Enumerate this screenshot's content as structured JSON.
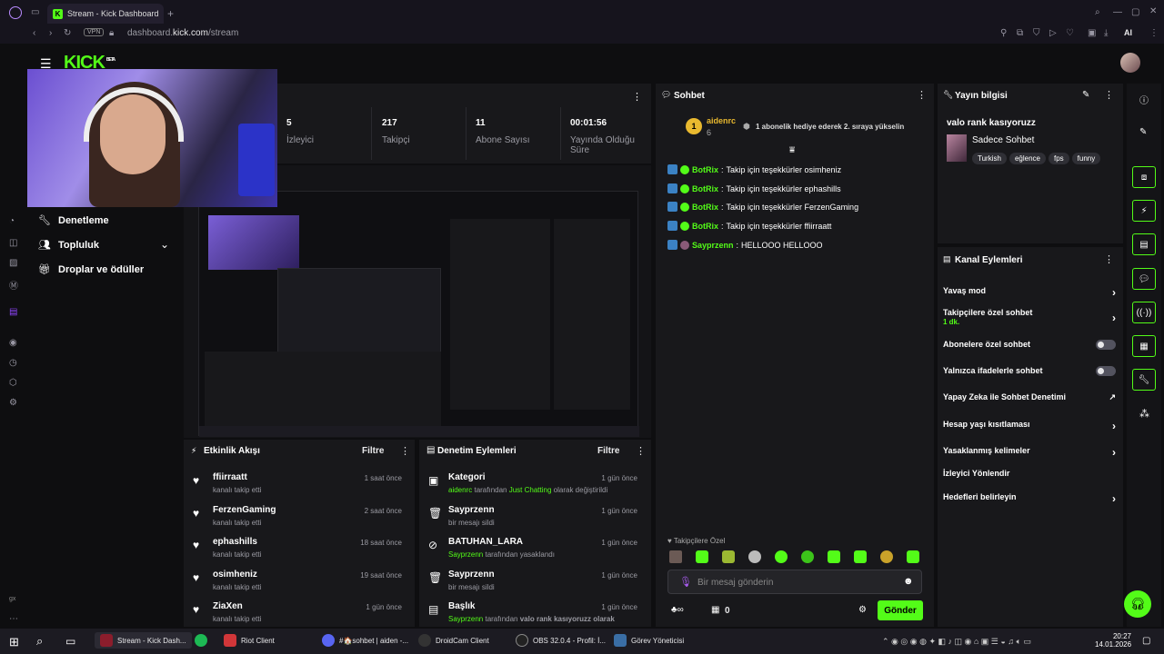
{
  "browser": {
    "tab_title": "Stream - Kick Dashboard",
    "url_domain": "dashboard.",
    "url_host": "kick.com",
    "url_path": "/stream",
    "vpn": "VPN",
    "ai_label": "AI"
  },
  "logo": {
    "text": "KICK",
    "beta": "BETA"
  },
  "sidebar": {
    "items": [
      {
        "label": "Denetleme",
        "icon": "wrench-icon"
      },
      {
        "label": "Topluluk",
        "icon": "users-icon"
      },
      {
        "label": "Droplar ve ödüller",
        "icon": "gift-icon"
      }
    ],
    "footer": "gx"
  },
  "stats": [
    {
      "value": "5",
      "label": "İzleyici"
    },
    {
      "value": "217",
      "label": "Takipçi"
    },
    {
      "value": "11",
      "label": "Abone Sayısı"
    },
    {
      "value": "00:01:56",
      "label": "Yayında Olduğu Süre"
    }
  ],
  "activity": {
    "title": "Etkinlik Akışı",
    "filter": "Filtre",
    "items": [
      {
        "name": "ffiirraatt",
        "sub": "kanalı takip etti",
        "time": "1 saat önce"
      },
      {
        "name": "FerzenGaming",
        "sub": "kanalı takip etti",
        "time": "2 saat önce"
      },
      {
        "name": "ephashills",
        "sub": "kanalı takip etti",
        "time": "18 saat önce"
      },
      {
        "name": "osimheniz",
        "sub": "kanalı takip etti",
        "time": "19 saat önce"
      },
      {
        "name": "ZiaXen",
        "sub": "kanalı takip etti",
        "time": "1 gün önce"
      }
    ]
  },
  "moderation": {
    "title": "Denetim Eylemleri",
    "filter": "Filtre",
    "items": [
      {
        "name": "Kategori",
        "actor": "aidenrc",
        "mid": " tarafından ",
        "hl": "Just Chatting",
        "rest": " olarak değiştirildi",
        "time": "1 gün önce",
        "icon": "category-icon"
      },
      {
        "name": "Sayprzenn",
        "actor": "",
        "mid": "bir mesajı sildi",
        "hl": "",
        "rest": "",
        "time": "1 gün önce",
        "icon": "trash-icon"
      },
      {
        "name": "BATUHAN_LARA",
        "actor": "Sayprzenn",
        "mid": " tarafından yasaklandı",
        "hl": "",
        "rest": "",
        "time": "1 gün önce",
        "icon": "ban-icon"
      },
      {
        "name": "Sayprzenn",
        "actor": "",
        "mid": "bir mesajı sildi",
        "hl": "",
        "rest": "",
        "time": "1 gün önce",
        "icon": "trash-icon"
      },
      {
        "name": "Başlık",
        "actor": "Sayprzenn",
        "mid": " tarafından ",
        "hl": "",
        "rest": "valo rank kasıyoruzz olarak",
        "time": "1 gün önce",
        "icon": "title-icon"
      }
    ]
  },
  "chat": {
    "title": "Sohbet",
    "pinned_user": "aidenrc",
    "pinned_count": "6",
    "pinned_rank": "1",
    "pinned_text": "1 abonelik hediye ederek 2. sıraya yükselin",
    "messages": [
      {
        "user": "BotRix",
        "text": "Takip için teşekkürler osimheniz",
        "color": "#53fc18"
      },
      {
        "user": "BotRix",
        "text": "Takip için teşekkürler ephashills",
        "color": "#53fc18"
      },
      {
        "user": "BotRix",
        "text": "Takip için teşekkürler FerzenGaming",
        "color": "#53fc18"
      },
      {
        "user": "BotRix",
        "text": "Takip için teşekkürler ffiirraatt",
        "color": "#53fc18"
      },
      {
        "user": "Sayprzenn",
        "text": "HELLOOO HELLOOO",
        "color": "#53fc18"
      }
    ],
    "followers_only": "Takipçilere Özel",
    "placeholder": "Bir mesaj gönderin",
    "count": "0",
    "send": "Gönder"
  },
  "stream_info": {
    "title": "Yayın bilgisi",
    "stream_title": "valo rank kasıyoruzz",
    "category": "Sadece Sohbet",
    "tags": [
      "Turkish",
      "eğlence",
      "fps",
      "funny"
    ]
  },
  "channel_actions": {
    "title": "Kanal Eylemleri",
    "items": [
      {
        "label": "Yavaş mod",
        "kind": "arrow"
      },
      {
        "label": "Takipçilere özel sohbet",
        "sub": "1 dk.",
        "kind": "arrow"
      },
      {
        "label": "Abonelere özel sohbet",
        "kind": "toggle"
      },
      {
        "label": "Yalnızca ifadelerle sohbet",
        "kind": "toggle"
      },
      {
        "label": "Yapay Zeka ile Sohbet Denetimi",
        "kind": "external"
      },
      {
        "label": "Hesap yaşı kısıtlaması",
        "kind": "arrow"
      },
      {
        "label": "Yasaklanmış kelimeler",
        "kind": "arrow"
      },
      {
        "label": "İzleyici Yönlendir",
        "kind": "none"
      },
      {
        "label": "Hedefleri belirleyin",
        "kind": "arrow"
      }
    ]
  },
  "taskbar": {
    "items": [
      {
        "label": "Stream - Kick Dash...",
        "color": "#8b1d2c"
      },
      {
        "label": "",
        "color": "#1db954"
      },
      {
        "label": "Riot Client",
        "color": "#d13639"
      },
      {
        "label": "#🏠sohbet | aiden -...",
        "color": "#5865f2"
      },
      {
        "label": "DroidCam Client",
        "color": "#333"
      },
      {
        "label": "OBS 32.0.4 - Profil: İ...",
        "color": "#222"
      },
      {
        "label": "Görev Yöneticisi",
        "color": "#3a6ea5"
      }
    ],
    "time": "20:27",
    "date": "14.01.2026"
  }
}
